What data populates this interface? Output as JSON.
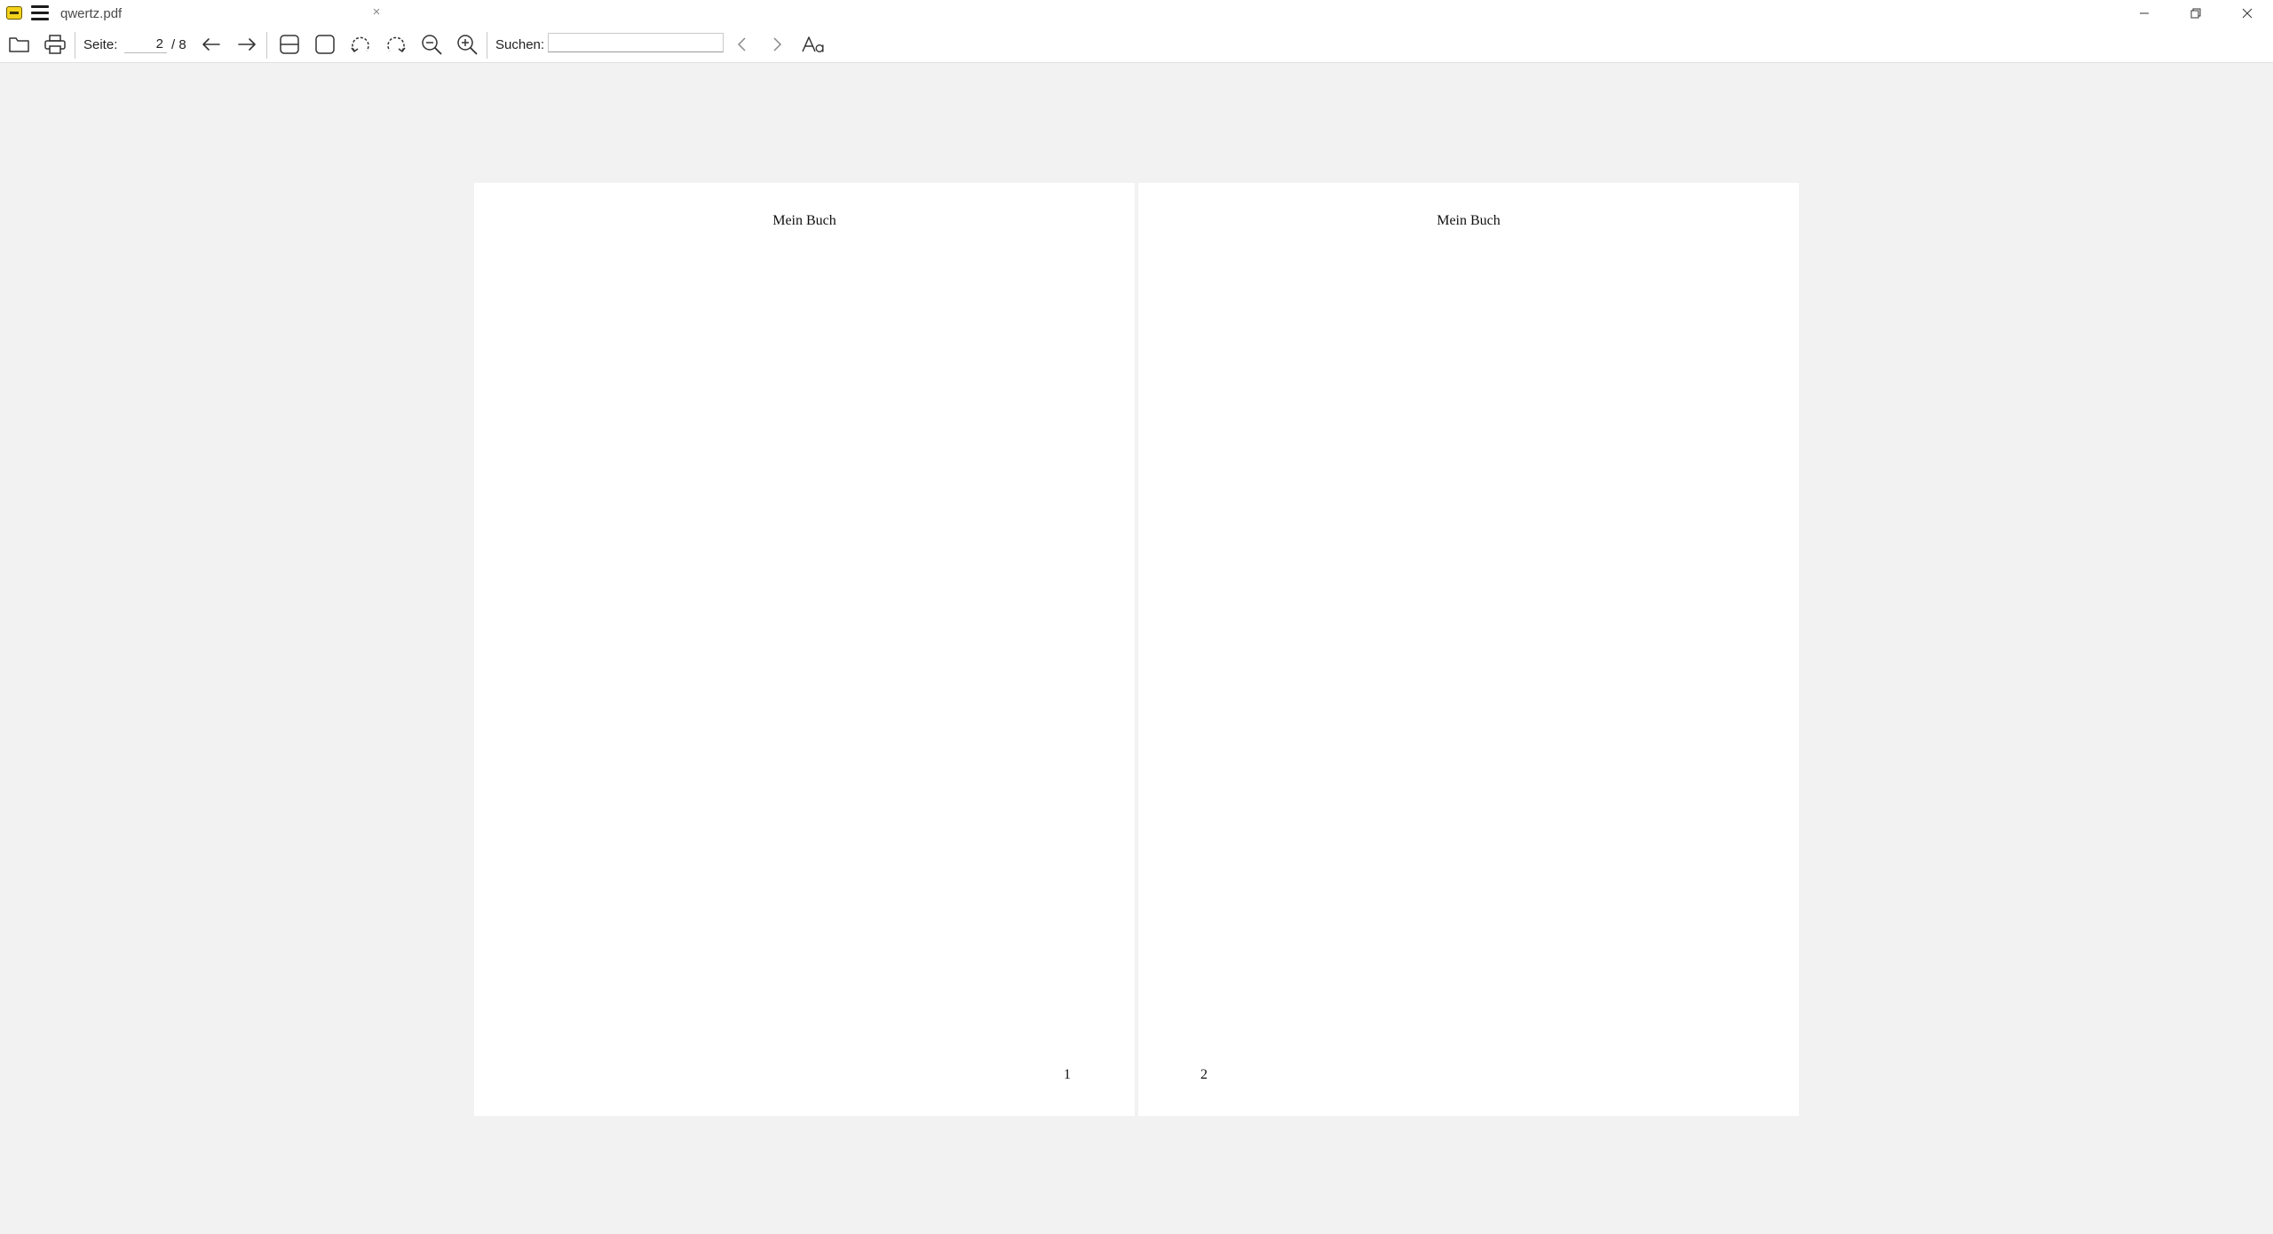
{
  "window": {
    "tab_title": "qwertz.pdf",
    "tab_close": "×"
  },
  "toolbar": {
    "page_label": "Seite:",
    "page_current": "2",
    "page_total": "/ 8",
    "search_label": "Suchen:",
    "search_value": ""
  },
  "document": {
    "pages": [
      {
        "header": "Mein Buch",
        "number": "1"
      },
      {
        "header": "Mein Buch",
        "number": "2"
      }
    ]
  }
}
